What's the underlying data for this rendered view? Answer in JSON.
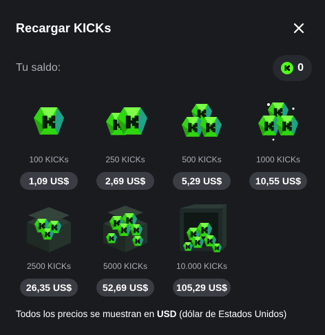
{
  "modal": {
    "title": "Recargar KICKs",
    "close_icon": "close-icon"
  },
  "balance": {
    "label": "Tu saldo:",
    "value": "0",
    "icon": "kick-coin-icon"
  },
  "packs": [
    {
      "name": "100 KICKs",
      "price": "1,09 US$",
      "art": "gem-single"
    },
    {
      "name": "250 KICKs",
      "price": "2,69 US$",
      "art": "gem-pair"
    },
    {
      "name": "500 KICKs",
      "price": "5,29 US$",
      "art": "gem-trio"
    },
    {
      "name": "1000 KICKs",
      "price": "10,55 US$",
      "art": "gem-cluster"
    },
    {
      "name": "2500 KICKs",
      "price": "26,35 US$",
      "art": "chest-small"
    },
    {
      "name": "5000 KICKs",
      "price": "52,69 US$",
      "art": "chest-full"
    },
    {
      "name": "10.000 KICKs",
      "price": "105,29 US$",
      "art": "vault"
    }
  ],
  "footer": {
    "prefix": "Todos los precios se muestran en ",
    "currency": "USD",
    "suffix": " (dólar de Estados Unidos)"
  },
  "colors": {
    "background": "#191b1f",
    "pill": "#3a3d43",
    "accent": "#53fc18",
    "muted_text": "#a9adb3"
  }
}
